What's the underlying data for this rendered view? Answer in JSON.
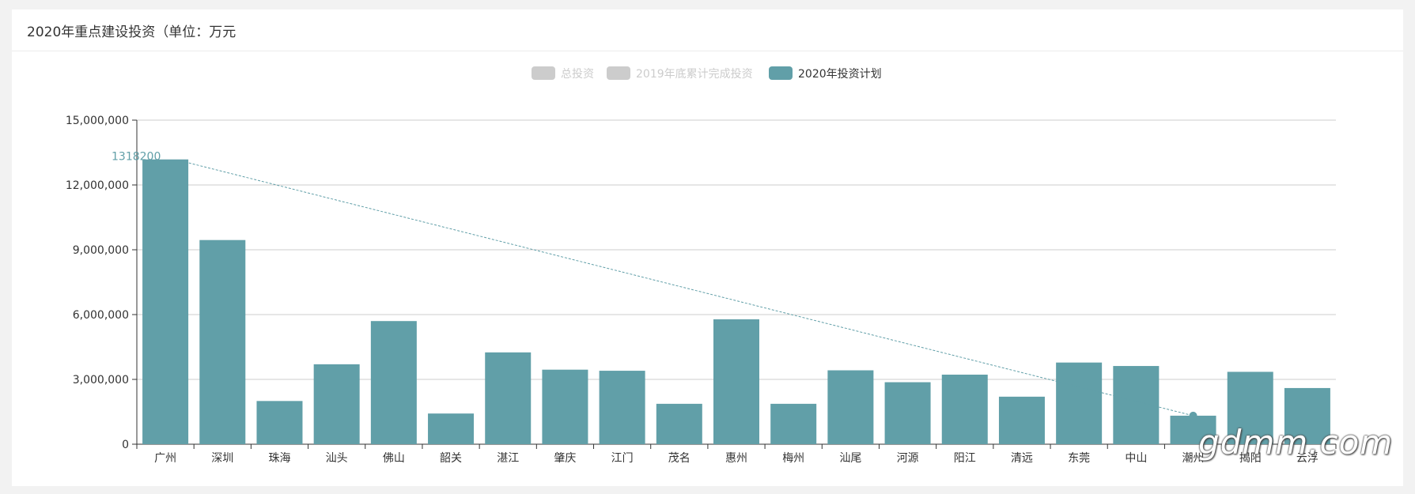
{
  "panel": {
    "title": "2020年重点建设投资（单位：万元"
  },
  "watermark": "gdmm.com",
  "colors": {
    "active_series": "#619fa8",
    "inactive_legend": "#cccccc",
    "axis": "#333333",
    "grid": "#cccccc",
    "trend": "#619fa8"
  },
  "chart_data": {
    "type": "bar",
    "title": "",
    "xlabel": "",
    "ylabel": "",
    "ylim": [
      0,
      15000000
    ],
    "yticks": [
      0,
      3000000,
      6000000,
      9000000,
      12000000,
      15000000
    ],
    "ytick_labels": [
      "0",
      "3,000,000",
      "6,000,000",
      "9,000,000",
      "12,000,000",
      "15,000,000"
    ],
    "grid": true,
    "legend_position": "top-center",
    "legend": [
      {
        "name": "总投资",
        "active": false
      },
      {
        "name": "2019年底累计完成投资",
        "active": false
      },
      {
        "name": "2020年投资计划",
        "active": true
      }
    ],
    "categories": [
      "广州",
      "深圳",
      "珠海",
      "汕头",
      "佛山",
      "韶关",
      "湛江",
      "肇庆",
      "江门",
      "茂名",
      "惠州",
      "梅州",
      "汕尾",
      "河源",
      "阳江",
      "清远",
      "东莞",
      "中山",
      "潮州",
      "揭阳",
      "云浮"
    ],
    "series": [
      {
        "name": "2020年投资计划",
        "values": [
          13182000,
          9450000,
          2000000,
          3700000,
          5700000,
          1420000,
          4250000,
          3450000,
          3400000,
          1870000,
          5780000,
          1870000,
          3420000,
          2870000,
          3220000,
          2200000,
          3780000,
          3620000,
          1320000,
          3350000,
          2600000
        ]
      }
    ],
    "annotations": [
      {
        "label": "1318200"
      }
    ]
  }
}
